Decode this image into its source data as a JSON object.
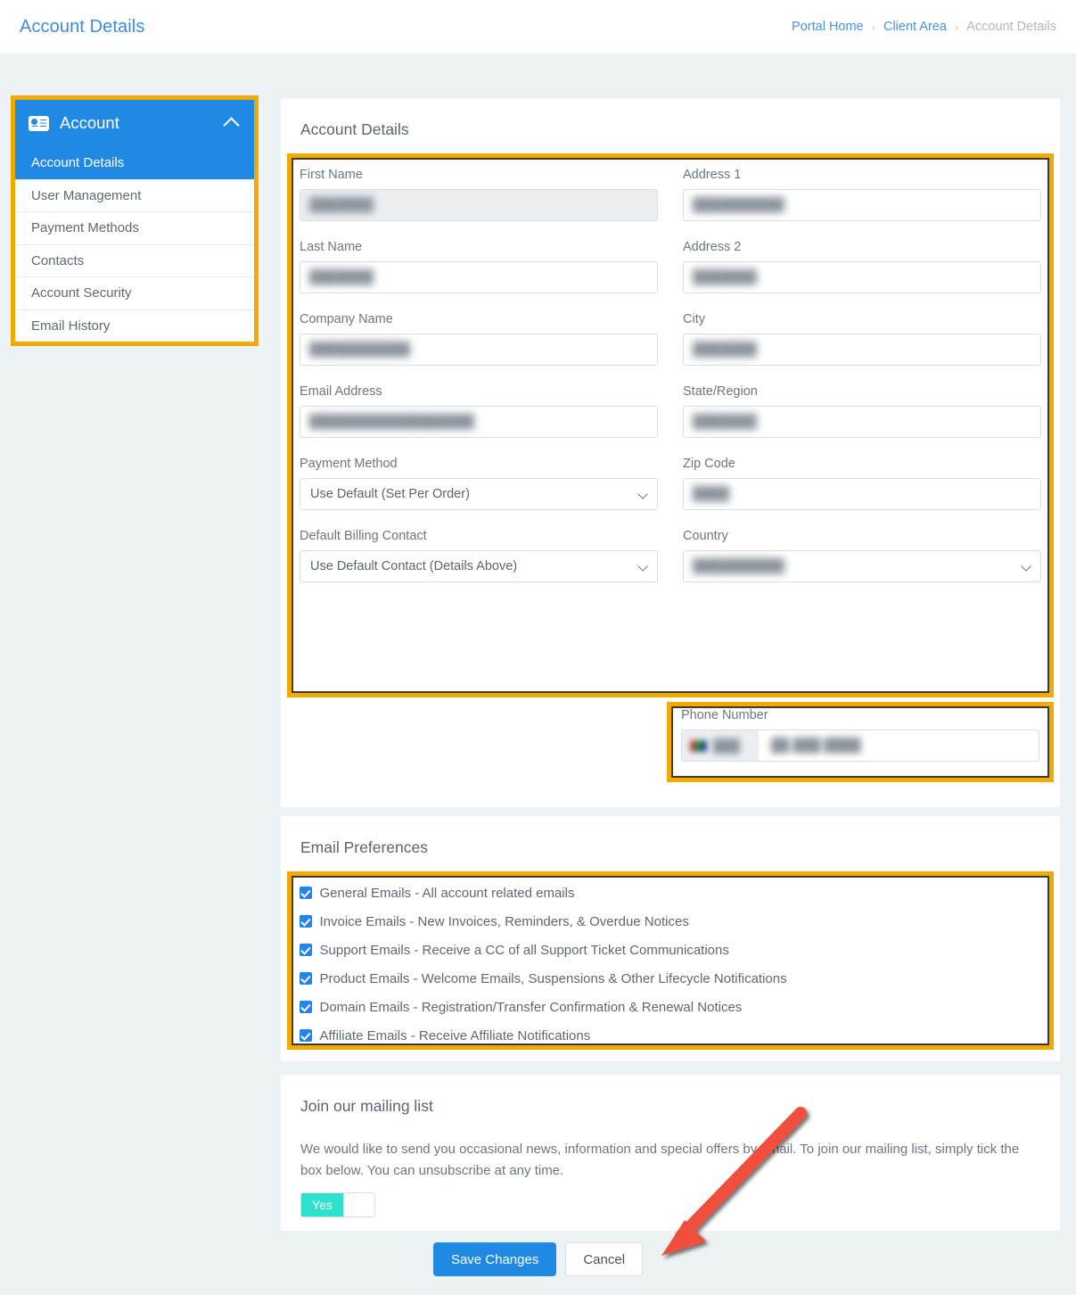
{
  "header": {
    "title": "Account Details",
    "breadcrumb": [
      {
        "label": "Portal Home",
        "current": false
      },
      {
        "label": "Client Area",
        "current": false
      },
      {
        "label": "Account Details",
        "current": true
      }
    ],
    "separator": "›"
  },
  "sidebar": {
    "icon": "id-card-icon",
    "title": "Account",
    "collapse_icon": "chevron-up-icon",
    "items": [
      {
        "label": "Account Details",
        "active": true
      },
      {
        "label": "User Management",
        "active": false
      },
      {
        "label": "Payment Methods",
        "active": false
      },
      {
        "label": "Contacts",
        "active": false
      },
      {
        "label": "Account Security",
        "active": false
      },
      {
        "label": "Email History",
        "active": false
      }
    ]
  },
  "account_details": {
    "card_title": "Account Details",
    "left_fields": [
      {
        "label": "First Name",
        "value": "███████",
        "type": "text",
        "readonly": true
      },
      {
        "label": "Last Name",
        "value": "███████",
        "type": "text",
        "readonly": false
      },
      {
        "label": "Company Name",
        "value": "███████████",
        "type": "text",
        "readonly": false
      },
      {
        "label": "Email Address",
        "value": "██████████████████",
        "type": "text",
        "readonly": false
      }
    ],
    "right_fields": [
      {
        "label": "Address 1",
        "value": "██████████",
        "type": "text",
        "readonly": false
      },
      {
        "label": "Address 2",
        "value": "███████",
        "type": "text",
        "readonly": false
      },
      {
        "label": "City",
        "value": "███████",
        "type": "text",
        "readonly": false
      },
      {
        "label": "State/Region",
        "value": "███████",
        "type": "text",
        "readonly": false
      },
      {
        "label": "Zip Code",
        "value": "████",
        "type": "text",
        "readonly": false
      }
    ],
    "payment_method": {
      "label": "Payment Method",
      "selected": "Use Default (Set Per Order)"
    },
    "billing_contact": {
      "label": "Default Billing Contact",
      "selected": "Use Default Contact (Details Above)"
    },
    "country": {
      "label": "Country",
      "selected": "██████████"
    },
    "phone": {
      "label": "Phone Number",
      "dial_code": "███",
      "number": "██ ███ ████"
    }
  },
  "email_preferences": {
    "card_title": "Email Preferences",
    "options": [
      {
        "label": "General Emails - All account related emails",
        "checked": true
      },
      {
        "label": "Invoice Emails - New Invoices, Reminders, & Overdue Notices",
        "checked": true
      },
      {
        "label": "Support Emails - Receive a CC of all Support Ticket Communications",
        "checked": true
      },
      {
        "label": "Product Emails - Welcome Emails, Suspensions & Other Lifecycle Notifications",
        "checked": true
      },
      {
        "label": "Domain Emails - Registration/Transfer Confirmation & Renewal Notices",
        "checked": true
      },
      {
        "label": "Affiliate Emails - Receive Affiliate Notifications",
        "checked": true
      }
    ]
  },
  "mailing_list": {
    "card_title": "Join our mailing list",
    "body": "We would like to send you occasional news, information and special offers by email. To join our mailing list, simply tick the box below. You can unsubscribe at any time.",
    "toggle_on_label": "Yes",
    "toggle_state": "on"
  },
  "footer": {
    "save_label": "Save Changes",
    "cancel_label": "Cancel"
  },
  "annotations": {
    "highlight_color": "#f2a900",
    "arrow_color": "#f0503c",
    "accent_blue": "#2089e4",
    "toggle_teal": "#2ee0cd"
  }
}
